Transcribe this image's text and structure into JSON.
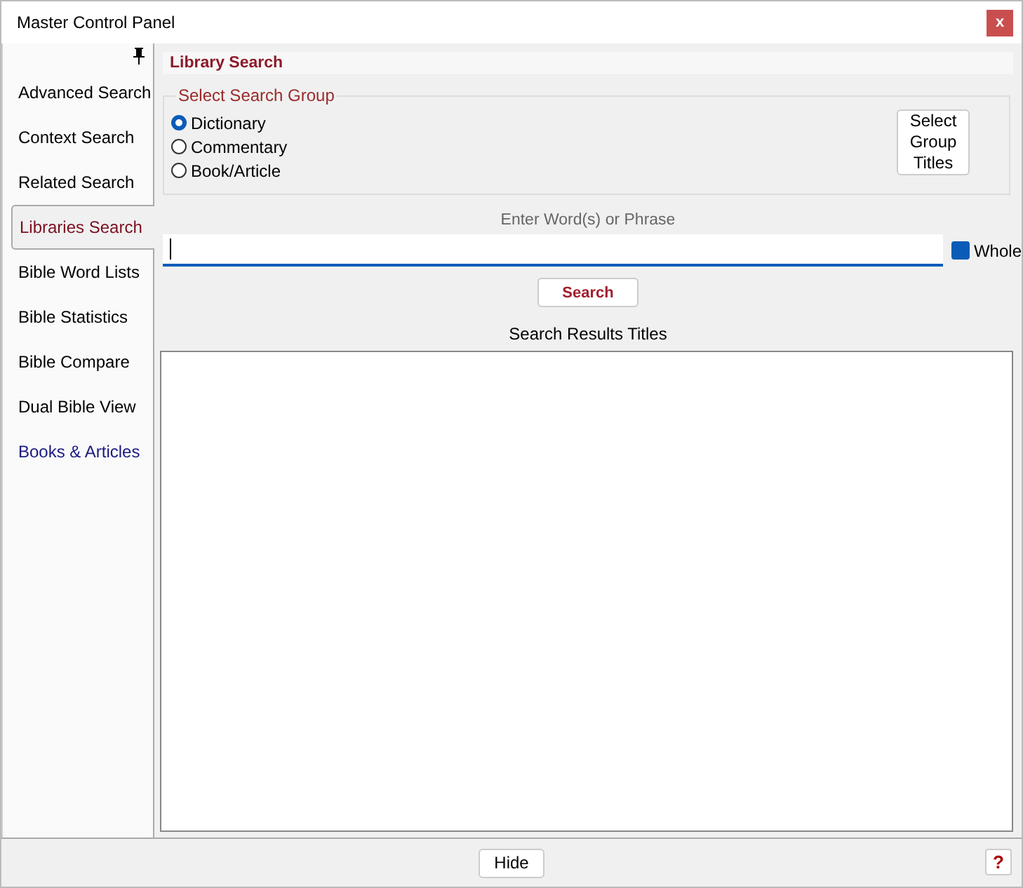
{
  "window": {
    "title": "Master Control Panel",
    "close": "x"
  },
  "sidebar": {
    "items": [
      {
        "label": "Advanced Search",
        "selected": false,
        "kind": "tab"
      },
      {
        "label": "Context Search",
        "selected": false,
        "kind": "tab"
      },
      {
        "label": "Related Search",
        "selected": false,
        "kind": "tab"
      },
      {
        "label": "Libraries Search",
        "selected": true,
        "kind": "tab"
      },
      {
        "label": "Bible Word Lists",
        "selected": false,
        "kind": "tab"
      },
      {
        "label": "Bible Statistics",
        "selected": false,
        "kind": "tab"
      },
      {
        "label": "Bible Compare",
        "selected": false,
        "kind": "tab"
      },
      {
        "label": "Dual Bible View",
        "selected": false,
        "kind": "tab"
      },
      {
        "label": "Books & Articles",
        "selected": false,
        "kind": "link"
      }
    ]
  },
  "panel": {
    "title": "Library Search",
    "group": {
      "legend": "Select Search Group",
      "options": [
        {
          "label": "Dictionary",
          "selected": true
        },
        {
          "label": "Commentary",
          "selected": false
        },
        {
          "label": "Book/Article",
          "selected": false
        }
      ],
      "button": "Select Group Titles"
    },
    "query_label": "Enter Word(s) or Phrase",
    "whole": {
      "label": "Whole",
      "checked": true
    },
    "search_button": "Search",
    "results_label": "Search Results Titles"
  },
  "footer": {
    "hide_button": "Hide",
    "help_button": "?"
  }
}
